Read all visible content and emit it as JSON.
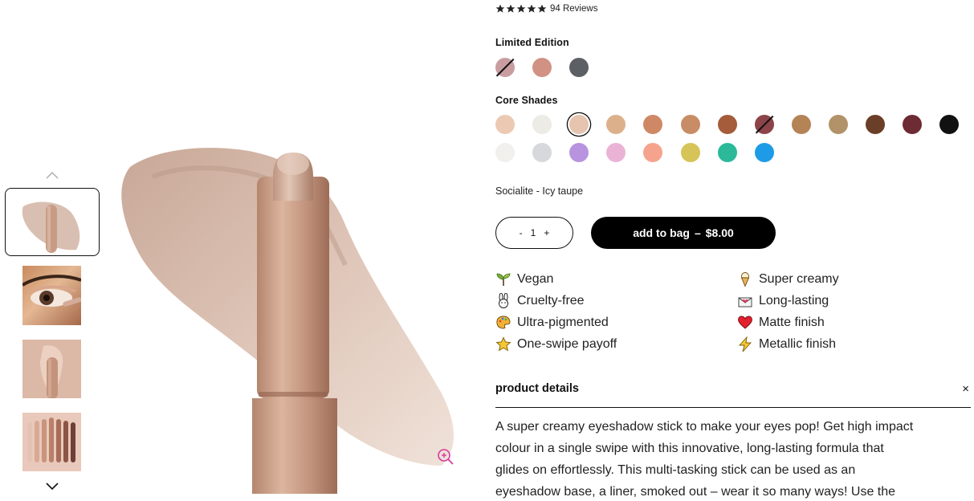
{
  "reviews": {
    "count_text": "94 Reviews",
    "rating": 5
  },
  "limited_edition": {
    "label": "Limited Edition",
    "swatches": [
      {
        "color": "#c99da0",
        "unavailable": true
      },
      {
        "color": "#d19283",
        "unavailable": false
      },
      {
        "color": "#5c5f63",
        "unavailable": false
      }
    ]
  },
  "core_shades": {
    "label": "Core Shades",
    "rows": [
      [
        {
          "color": "#ecc9b3"
        },
        {
          "color": "#ecebe6"
        },
        {
          "color": "#e6c4b0",
          "selected": true
        },
        {
          "color": "#ddb08c"
        },
        {
          "color": "#cf8866"
        },
        {
          "color": "#c88d66"
        },
        {
          "color": "#a45c3a"
        },
        {
          "color": "#8c4448",
          "unavailable": true
        },
        {
          "color": "#b48356"
        },
        {
          "color": "#b29268"
        },
        {
          "color": "#6a3e27"
        },
        {
          "color": "#6d2b33"
        },
        {
          "color": "#111111"
        }
      ],
      [
        {
          "color": "#f1f0ec"
        },
        {
          "color": "#d6d8dc"
        },
        {
          "color": "#b894e0"
        },
        {
          "color": "#eab3d6"
        },
        {
          "color": "#f6a38e"
        },
        {
          "color": "#d6c458"
        },
        {
          "color": "#2bb99a"
        },
        {
          "color": "#1e9be6"
        }
      ]
    ]
  },
  "selected_shade": "Socialite - Icy taupe",
  "quantity": {
    "minus": "-",
    "value": "1",
    "plus": "+"
  },
  "add_to_bag": {
    "label": "add to bag",
    "separator": "–",
    "price": "$8.00"
  },
  "features": {
    "left": [
      {
        "icon": "sprout-icon",
        "label": "Vegan"
      },
      {
        "icon": "bunny-icon",
        "label": "Cruelty-free"
      },
      {
        "icon": "palette-icon",
        "label": "Ultra-pigmented"
      },
      {
        "icon": "star-icon",
        "label": "One-swipe payoff"
      }
    ],
    "right": [
      {
        "icon": "ice-cream-icon",
        "label": "Super creamy"
      },
      {
        "icon": "envelope-heart-icon",
        "label": "Long-lasting"
      },
      {
        "icon": "heart-icon",
        "label": "Matte finish"
      },
      {
        "icon": "lightning-icon",
        "label": "Metallic finish"
      }
    ]
  },
  "product_details": {
    "title": "product details",
    "close": "×",
    "lines": [
      "A super creamy eyeshadow stick to make your eyes pop! Get high impact",
      "colour in a single swipe with this innovative, long-lasting formula that",
      "glides on effortlessly. This multi-tasking stick can be used as an",
      "eyeshadow base, a liner, smoked out – wear it so many ways! Use the"
    ]
  },
  "colors": {
    "accent": "#000000",
    "zoom_icon": "#d63a9f"
  }
}
